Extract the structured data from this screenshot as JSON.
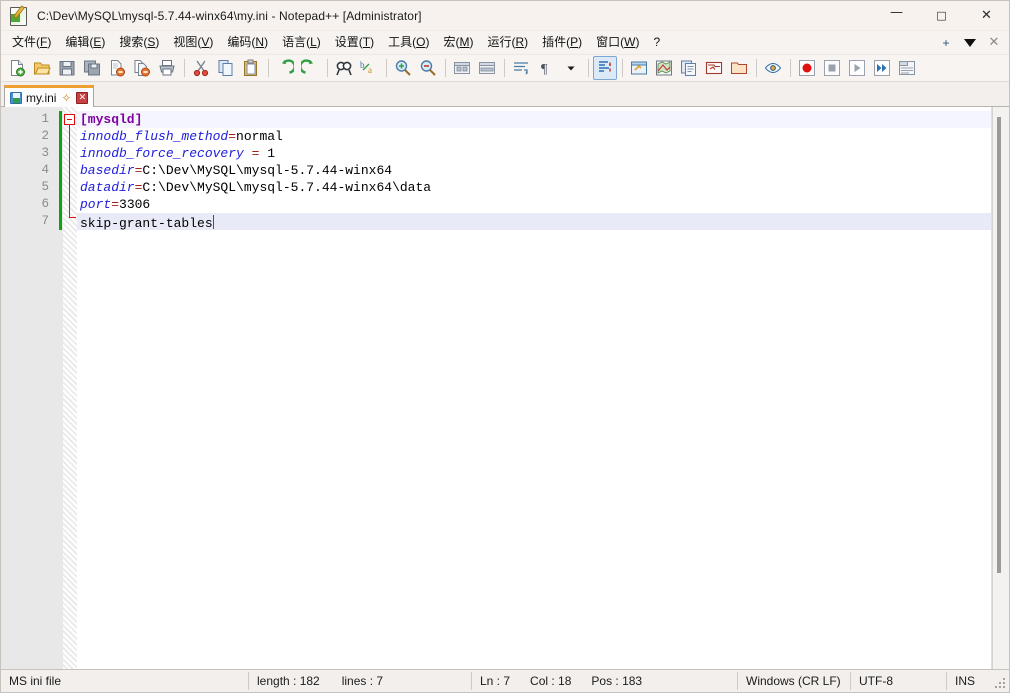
{
  "window": {
    "title": "C:\\Dev\\MySQL\\mysql-5.7.44-winx64\\my.ini - Notepad++ [Administrator]",
    "icon": "notepad-plus-plus-icon",
    "controls": {
      "minimize": "—",
      "maximize": "□",
      "close": "✕"
    }
  },
  "menu": {
    "items": [
      {
        "label": "文件(F)",
        "name": "menu-file"
      },
      {
        "label": "编辑(E)",
        "name": "menu-edit"
      },
      {
        "label": "搜索(S)",
        "name": "menu-search"
      },
      {
        "label": "视图(V)",
        "name": "menu-view"
      },
      {
        "label": "编码(N)",
        "name": "menu-encoding"
      },
      {
        "label": "语言(L)",
        "name": "menu-language"
      },
      {
        "label": "设置(T)",
        "name": "menu-settings"
      },
      {
        "label": "工具(O)",
        "name": "menu-tools"
      },
      {
        "label": "宏(M)",
        "name": "menu-macro"
      },
      {
        "label": "运行(R)",
        "name": "menu-run"
      },
      {
        "label": "插件(P)",
        "name": "menu-plugins"
      },
      {
        "label": "窗口(W)",
        "name": "menu-window"
      },
      {
        "label": "?",
        "name": "menu-help"
      }
    ],
    "right": {
      "plus": "+",
      "dropdown": "dropdown-triangle-icon",
      "close": "✕"
    }
  },
  "toolbar": {
    "buttons": [
      {
        "name": "new-file-icon",
        "title": "新建"
      },
      {
        "name": "open-file-icon",
        "title": "打开"
      },
      {
        "name": "save-icon",
        "title": "保存"
      },
      {
        "name": "save-all-icon",
        "title": "保存所有"
      },
      {
        "name": "close-file-icon",
        "title": "关闭"
      },
      {
        "name": "close-all-icon",
        "title": "关闭所有"
      },
      {
        "name": "print-icon",
        "title": "打印"
      },
      {
        "name": "cut-icon",
        "title": "剪切"
      },
      {
        "name": "copy-icon",
        "title": "复制"
      },
      {
        "name": "paste-icon",
        "title": "粘贴"
      },
      {
        "name": "undo-icon",
        "title": "撤销"
      },
      {
        "name": "redo-icon",
        "title": "重做"
      },
      {
        "name": "find-icon",
        "title": "查找"
      },
      {
        "name": "replace-icon",
        "title": "替换"
      },
      {
        "name": "zoom-in-icon",
        "title": "放大"
      },
      {
        "name": "zoom-out-icon",
        "title": "缩小"
      },
      {
        "name": "sync-vertical-icon",
        "title": "同步垂直滚动"
      },
      {
        "name": "sync-horizontal-icon",
        "title": "同步水平滚动"
      },
      {
        "name": "word-wrap-icon",
        "title": "自动换行"
      },
      {
        "name": "show-all-chars-icon",
        "title": "显示所有字符"
      },
      {
        "name": "indent-guide-icon",
        "title": "缩进参考线"
      },
      {
        "name": "user-defined-dialog-icon",
        "title": "用户自定义语言"
      },
      {
        "name": "document-map-icon",
        "title": "文档地图"
      },
      {
        "name": "function-list-icon",
        "title": "函数列表"
      },
      {
        "name": "folder-workspace-icon",
        "title": "文件夹作为工作区"
      },
      {
        "name": "monitoring-icon",
        "title": "监视文件"
      },
      {
        "name": "macro-record-icon",
        "title": "开始录制宏"
      },
      {
        "name": "macro-stop-icon",
        "title": "停止录制宏"
      },
      {
        "name": "macro-play-icon",
        "title": "播放宏"
      },
      {
        "name": "macro-run-multiple-icon",
        "title": "多次运行宏"
      },
      {
        "name": "macro-save-icon",
        "title": "保存当前录制的宏"
      }
    ]
  },
  "tabs": [
    {
      "label": "my.ini",
      "saved": true,
      "pin": "✂",
      "close": "✕"
    }
  ],
  "editor": {
    "line_numbers": [
      "1",
      "2",
      "3",
      "4",
      "5",
      "6",
      "7"
    ],
    "current_line": 7,
    "lines": [
      {
        "n": 1,
        "type": "section",
        "text": "[mysqld]"
      },
      {
        "n": 2,
        "type": "pair",
        "key": "innodb_flush_method",
        "eq": "=",
        "value": "normal"
      },
      {
        "n": 3,
        "type": "pair",
        "key": "innodb_force_recovery",
        "eq": " = ",
        "value": "1"
      },
      {
        "n": 4,
        "type": "pair",
        "key": "basedir",
        "eq": "=",
        "value": "C:\\Dev\\MySQL\\mysql-5.7.44-winx64"
      },
      {
        "n": 5,
        "type": "pair",
        "key": "datadir",
        "eq": "=",
        "value": "C:\\Dev\\MySQL\\mysql-5.7.44-winx64\\data"
      },
      {
        "n": 6,
        "type": "pair",
        "key": "port",
        "eq": "=",
        "value": "3306"
      },
      {
        "n": 7,
        "type": "plain",
        "text": "skip-grant-tables"
      }
    ]
  },
  "statusbar": {
    "file_type": "MS ini file",
    "length_label": "length : 182",
    "lines_label": "lines : 7",
    "ln": "Ln : 7",
    "col": "Col : 18",
    "pos": "Pos : 183",
    "eol": "Windows (CR LF)",
    "encoding": "UTF-8",
    "insert_mode": "INS"
  },
  "colors": {
    "section": "#8000a0",
    "key": "#2020dd",
    "equals": "#a02020",
    "value": "#000000",
    "current_line_bg": "#e8eaf8",
    "caret": "#7030a0",
    "change_bar": "#14a014",
    "fold_line": "#e01010",
    "tab_active_top": "#f0a030"
  }
}
